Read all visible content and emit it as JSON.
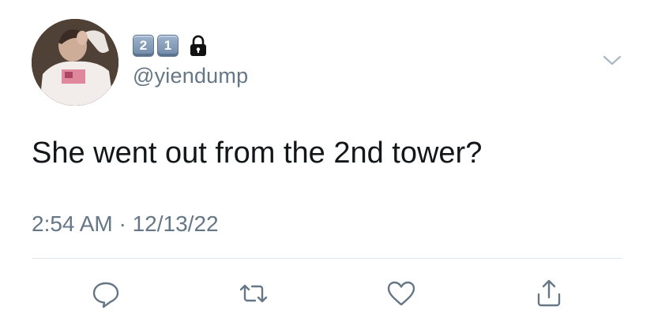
{
  "user": {
    "badges": [
      "2",
      "1"
    ],
    "handle": "@yiendump",
    "avatar_icon": "profile-photo",
    "lock_icon": "lock-icon"
  },
  "tweet": {
    "text": "She went out from the 2nd tower?",
    "timestamp": "2:54 AM · 12/13/22"
  },
  "actions": [
    {
      "name": "reply",
      "icon": "reply-icon"
    },
    {
      "name": "retweet",
      "icon": "retweet-icon"
    },
    {
      "name": "like",
      "icon": "heart-icon"
    },
    {
      "name": "share",
      "icon": "share-icon"
    }
  ],
  "colors": {
    "text": "#14171a",
    "secondary": "#657786",
    "divider": "#e1e8ed",
    "badge": "#7f97b5"
  }
}
